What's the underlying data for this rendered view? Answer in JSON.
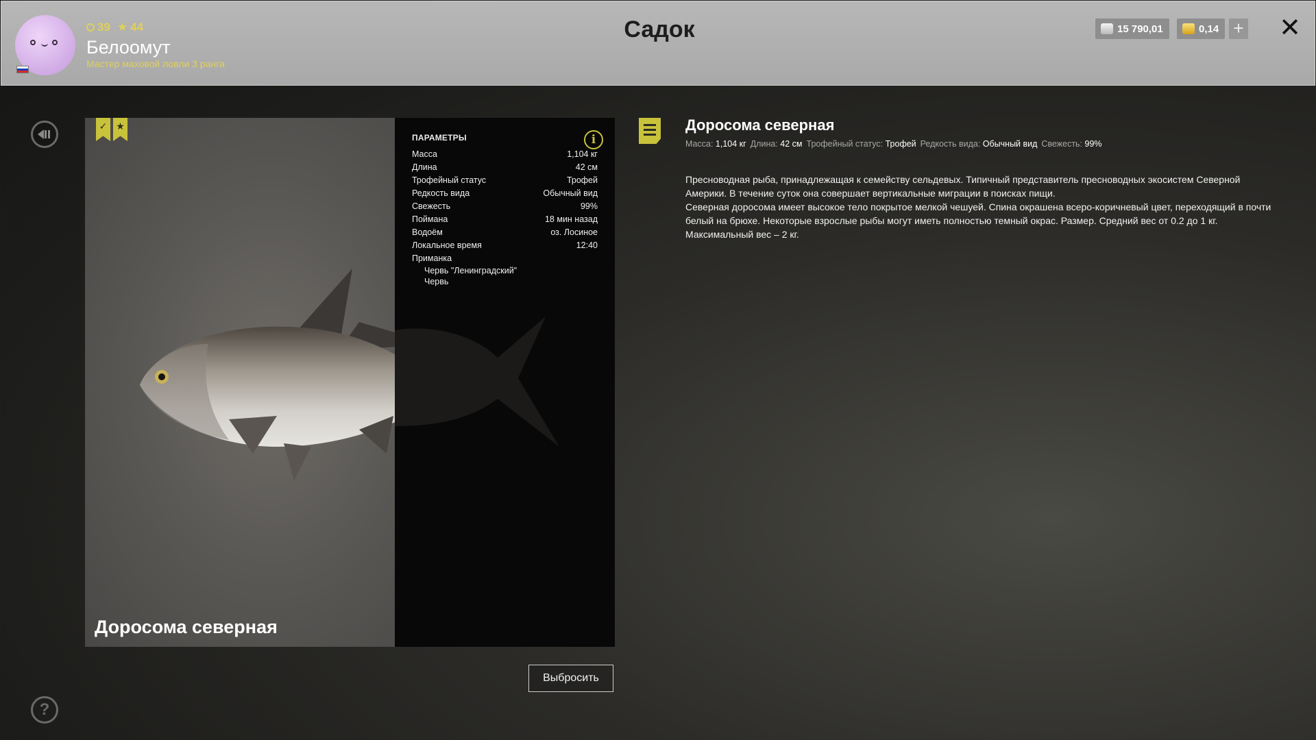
{
  "header": {
    "level": "39",
    "rank": "44",
    "player_name": "Белоомут",
    "player_title": "Мастер маховой ловли 3 ранга",
    "page_title": "Садок",
    "silver_amount": "15 790,01",
    "gold_amount": "0,14",
    "plus_label": "+",
    "close_label": "✕"
  },
  "card": {
    "fish_name": "Доросома северная",
    "params_title": "ПАРАМЕТРЫ",
    "info_label": "i",
    "params": [
      {
        "label": "Масса",
        "value": "1,104 кг"
      },
      {
        "label": "Длина",
        "value": "42 см"
      },
      {
        "label": "Трофейный статус",
        "value": "Трофей"
      },
      {
        "label": "Редкость вида",
        "value": "Обычный вид"
      },
      {
        "label": "Свежесть",
        "value": "99%"
      },
      {
        "label": "Поймана",
        "value": "18 мин назад"
      },
      {
        "label": "Водоём",
        "value": "оз. Лосиное"
      },
      {
        "label": "Локальное время",
        "value": "12:40"
      }
    ],
    "bait_label": "Приманка",
    "bait_items": [
      "Червь \"Ленинградский\"",
      "Червь"
    ],
    "discard_label": "Выбросить"
  },
  "description": {
    "title": "Доросома северная",
    "meta": [
      {
        "label": "Масса:",
        "value": "1,104 кг"
      },
      {
        "label": "Длина:",
        "value": "42 см"
      },
      {
        "label": "Трофейный статус:",
        "value": "Трофей"
      },
      {
        "label": "Редкость вида:",
        "value": "Обычный вид"
      },
      {
        "label": "Свежесть:",
        "value": "99%"
      }
    ],
    "paragraph1": "Пресноводная рыба, принадлежащая к семейству сельдевых. Типичный представитель пресноводных экосистем Северной Америки. В течение суток она совершает вертикальные миграции в поисках пищи.",
    "paragraph2": "Северная доросома имеет высокое тело покрытое мелкой чешуей. Спина окрашена всеро-коричневый цвет, переходящий в почти белый на брюхе. Некоторые взрослые рыбы могут иметь полностью темный окрас. Размер. Средний вес от 0.2 до 1 кг. Максимальный вес – 2 кг."
  },
  "help_label": "?",
  "icons": {
    "back": "back-arrow-icon",
    "help": "question-icon",
    "badge1": "checkmark-badge-icon",
    "badge2": "star-badge-icon",
    "note": "note-icon",
    "info": "info-icon",
    "silver": "silver-coin-icon",
    "gold": "gold-coin-icon"
  },
  "colors": {
    "accent": "#c9c23b",
    "header_bg": "#b0b0b0",
    "level_text": "#e1d05a"
  }
}
